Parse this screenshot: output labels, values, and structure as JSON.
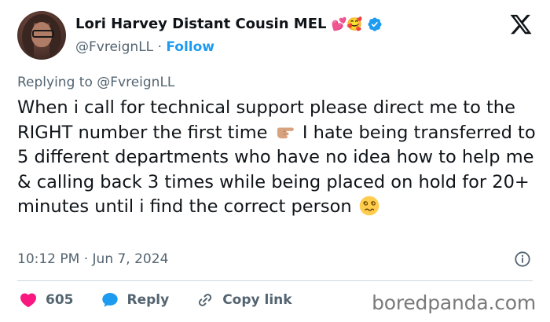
{
  "author": {
    "display_name": "Lori Harvey Distant Cousin MEL",
    "name_emojis": "💕🥰",
    "handle": "@FvreignLL",
    "separator": "·",
    "follow_label": "Follow"
  },
  "reply": {
    "prefix": "Replying to",
    "mention": "@FvreignLL"
  },
  "tweet": {
    "text_part1": "When i call for technical support please direct me to the RIGHT number the first time",
    "text_part2": "I hate being transferred to 5 different departments who have no idea how to help me & calling back 3 times while being placed on hold for 20+ minutes until i find the correct person",
    "emoji_1": "pointing-right-hand-emoji",
    "emoji_2": "dizzy-face-emoji"
  },
  "meta": {
    "timestamp": "10:12 PM · Jun 7, 2024"
  },
  "actions": {
    "like_count": "605",
    "reply_label": "Reply",
    "copy_link_label": "Copy link"
  },
  "watermark": "boredpanda.com",
  "colors": {
    "accent": "#1d9bf0",
    "like": "#f91880",
    "muted": "#536471",
    "text": "#0f1419"
  }
}
